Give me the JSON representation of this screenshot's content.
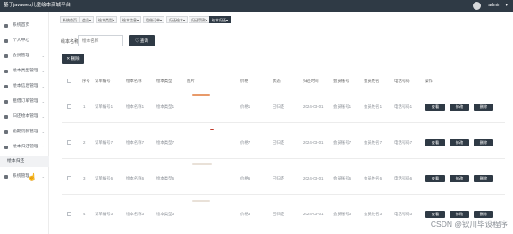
{
  "header": {
    "title": "基于javaweb儿童绘本商城平台",
    "admin": "admin",
    "caret": "▾"
  },
  "sidebar": {
    "items": [
      {
        "label": "系统首页",
        "icon": "home-icon"
      },
      {
        "label": "个人中心",
        "icon": "user-icon"
      },
      {
        "label": "会员管理",
        "icon": "grid-icon"
      },
      {
        "label": "绘本类型管理",
        "icon": "grid-icon"
      },
      {
        "label": "绘本信息管理",
        "icon": "grid-icon"
      },
      {
        "label": "租借订单管理",
        "icon": "grid-icon"
      },
      {
        "label": "归还绘本管理",
        "icon": "grid-icon"
      },
      {
        "label": "逾期罚款管理",
        "icon": "grid-icon"
      },
      {
        "label": "绘本归还管理",
        "icon": "send-icon"
      },
      {
        "label": "系统管理",
        "icon": "grid-icon"
      }
    ],
    "sub_item": "绘本归还"
  },
  "breadcrumbs": [
    "系统首页",
    "会员▾",
    "绘本类型▾",
    "绘本信息▾",
    "租借订单▾",
    "归还绘本▾",
    "归还罚款▾",
    "绘本归还▾"
  ],
  "search": {
    "label": "绘本名称",
    "placeholder": "绘本名称",
    "button": "♡ 查询"
  },
  "toolbar": {
    "delete": "✕ 删除"
  },
  "table": {
    "headers": [
      "序号",
      "订单编号",
      "绘本名称",
      "绘本类型",
      "图片",
      "价格",
      "状态",
      "归还时间",
      "会员账号",
      "会员姓名",
      "电话号码",
      "操作"
    ],
    "rows": [
      {
        "index": "1",
        "order": "订单编号1",
        "name": "绘本名称1",
        "type": "绘本类型1",
        "price": "价格1",
        "status": "已归还",
        "time": "2024-03-01",
        "account": "会员账号1",
        "member": "会员姓名1",
        "phone": "电话号码1"
      },
      {
        "index": "2",
        "order": "订单编号7",
        "name": "绘本名称7",
        "type": "绘本类型7",
        "price": "价格7",
        "status": "已归还",
        "time": "2024-03-01",
        "account": "会员账号7",
        "member": "会员姓名7",
        "phone": "电话号码7"
      },
      {
        "index": "3",
        "order": "订单编号6",
        "name": "绘本名称6",
        "type": "绘本类型6",
        "price": "价格6",
        "status": "已归还",
        "time": "2024-03-01",
        "account": "会员账号6",
        "member": "会员姓名6",
        "phone": "电话号码6"
      },
      {
        "index": "4",
        "order": "订单编号3",
        "name": "绘本名称3",
        "type": "绘本类型3",
        "price": "价格3",
        "status": "已归还",
        "time": "2024-03-01",
        "account": "会员账号3",
        "member": "会员姓名3",
        "phone": "电话号码3"
      }
    ],
    "actions": [
      "查看",
      "修改",
      "删除"
    ]
  },
  "watermark": "CSDN @钬川毕设程序",
  "colors": {
    "dark": "#2f3a45",
    "accent_orange": "#e89a6a"
  }
}
